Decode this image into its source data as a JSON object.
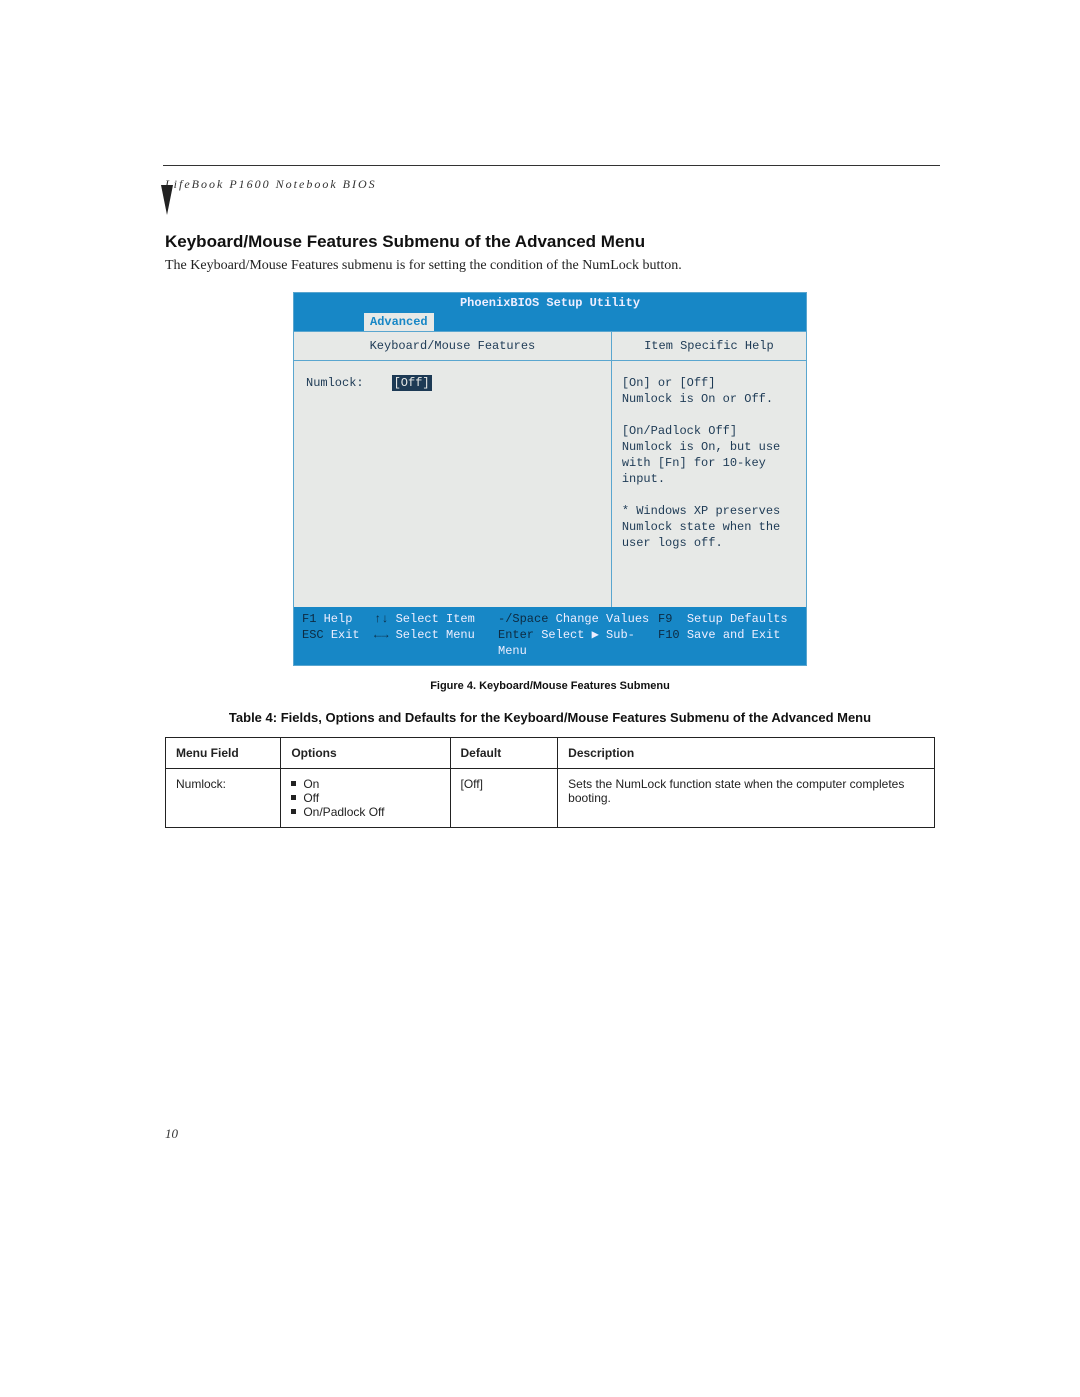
{
  "header": "LifeBook P1600 Notebook BIOS",
  "section_title": "Keyboard/Mouse Features Submenu of the Advanced Menu",
  "intro": "The Keyboard/Mouse Features submenu is for setting the condition of the NumLock button.",
  "bios": {
    "title": "PhoenixBIOS Setup Utility",
    "active_tab": "Advanced",
    "left_heading": "Keyboard/Mouse Features",
    "right_heading": "Item Specific Help",
    "field_label": "Numlock:",
    "field_value": "[Off]",
    "help_text": "[On] or [Off]\nNumlock is On or Off.\n\n[On/Padlock Off]\nNumlock is On, but use\nwith [Fn] for 10-key\ninput.\n\n* Windows XP preserves\nNumlock state when the\nuser logs off.",
    "footer": {
      "r1": {
        "k1": "F1",
        "l1": "Help",
        "k2": "↑↓",
        "l2": "Select Item",
        "k3": "-/Space",
        "l3": "Change Values",
        "k4": "F9",
        "l4": "Setup Defaults"
      },
      "r2": {
        "k1": "ESC",
        "l1": "Exit",
        "k2": "←→",
        "l2": "Select Menu",
        "k3": "Enter",
        "l3": "Select ▶ Sub-Menu",
        "k4": "F10",
        "l4": "Save and Exit"
      }
    }
  },
  "figure_caption": "Figure 4.  Keyboard/Mouse Features Submenu",
  "table_title": "Table 4: Fields, Options and Defaults for the Keyboard/Mouse Features Submenu of the Advanced Menu",
  "table": {
    "headers": {
      "menu_field": "Menu Field",
      "options": "Options",
      "default": "Default",
      "description": "Description"
    },
    "row": {
      "menu_field": "Numlock:",
      "options": [
        "On",
        "Off",
        "On/Padlock Off"
      ],
      "default": "[Off]",
      "description": "Sets the NumLock function state when the computer completes booting."
    }
  },
  "page_number": "10"
}
